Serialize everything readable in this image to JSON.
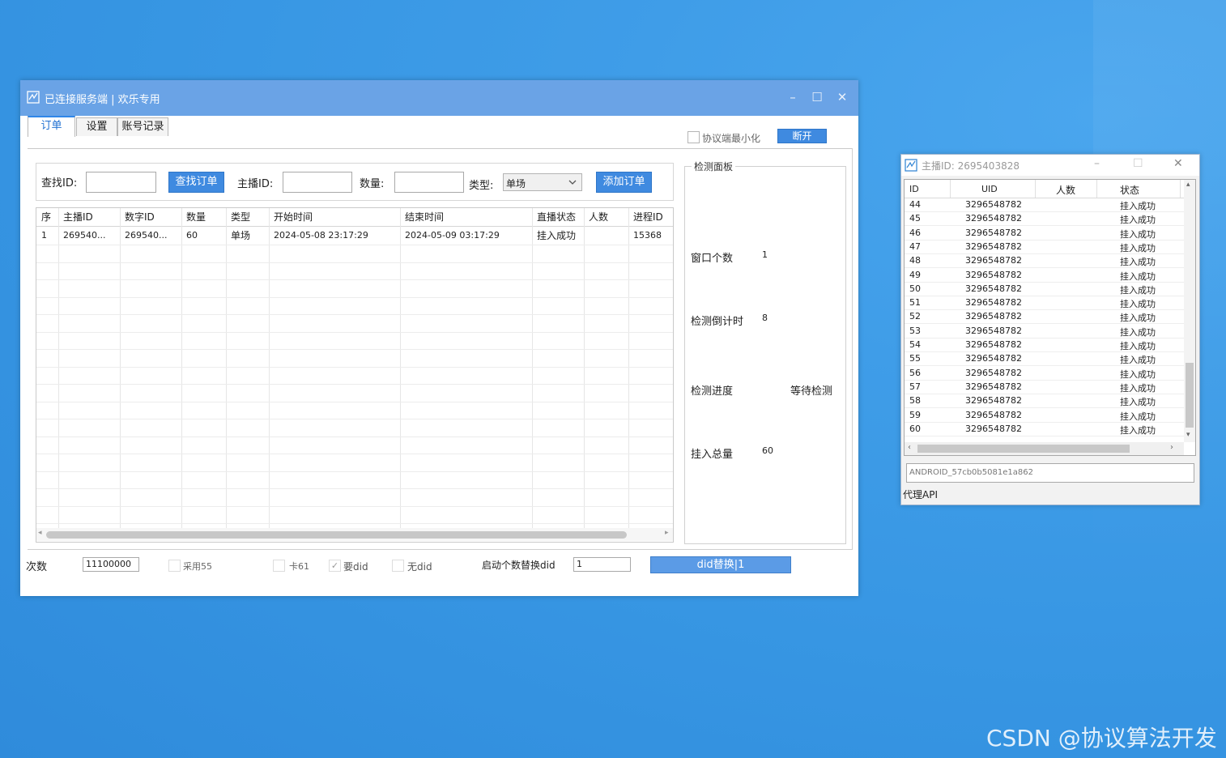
{
  "main_window": {
    "title": "已连接服务端 | 欢乐专用",
    "controls": [
      "–",
      "☐",
      "✕"
    ],
    "tabs": [
      {
        "label": "订单",
        "active": true
      },
      {
        "label": "设置",
        "active": false
      },
      {
        "label": "账号记录",
        "active": false
      }
    ],
    "protocol_minimize_label": "协议端最小化",
    "disconnect_label": "断开",
    "search": {
      "find_id_label": "查找ID:",
      "find_id_value": "",
      "find_button": "查找订单",
      "anchor_id_label": "主播ID:",
      "anchor_id_value": "",
      "quantity_label": "数量:",
      "quantity_value": "",
      "type_label": "类型:",
      "type_value": "单场",
      "add_button": "添加订单"
    },
    "table": {
      "columns": [
        "序",
        "主播ID",
        "数字ID",
        "数量",
        "类型",
        "开始时间",
        "结束时间",
        "直播状态",
        "人数",
        "进程ID"
      ],
      "rows": [
        [
          "1",
          "269540...",
          "269540...",
          "60",
          "单场",
          "2024-05-08 23:17:29",
          "2024-05-09 03:17:29",
          "挂入成功",
          "",
          "15368"
        ]
      ]
    },
    "detect_panel": {
      "title": "检测面板",
      "window_count_label": "窗口个数",
      "window_count_value": "1",
      "countdown_label": "检测倒计时",
      "countdown_value": "8",
      "progress_label": "检测进度",
      "progress_value": "等待检测",
      "total_label": "挂入总量",
      "total_value": "60"
    },
    "bottom": {
      "count_label": "次数",
      "count_value": "11100000",
      "use55_label": "采用55",
      "card61_label": "卡61",
      "need_did_label": "要did",
      "no_did_label": "无did",
      "start_replace_label": "启动个数替换did",
      "start_replace_value": "1",
      "did_replace_button": "did替换|1"
    }
  },
  "secondary_window": {
    "title": "主播ID: 2695403828",
    "controls": [
      "–",
      "☐",
      "✕"
    ],
    "columns": [
      "ID",
      "UID",
      "人数",
      "状态"
    ],
    "rows": [
      {
        "id": "44",
        "uid": "3296548782",
        "count": "",
        "status": "挂入成功"
      },
      {
        "id": "45",
        "uid": "3296548782",
        "count": "",
        "status": "挂入成功"
      },
      {
        "id": "46",
        "uid": "3296548782",
        "count": "",
        "status": "挂入成功"
      },
      {
        "id": "47",
        "uid": "3296548782",
        "count": "",
        "status": "挂入成功"
      },
      {
        "id": "48",
        "uid": "3296548782",
        "count": "",
        "status": "挂入成功"
      },
      {
        "id": "49",
        "uid": "3296548782",
        "count": "",
        "status": "挂入成功"
      },
      {
        "id": "50",
        "uid": "3296548782",
        "count": "",
        "status": "挂入成功"
      },
      {
        "id": "51",
        "uid": "3296548782",
        "count": "",
        "status": "挂入成功"
      },
      {
        "id": "52",
        "uid": "3296548782",
        "count": "",
        "status": "挂入成功"
      },
      {
        "id": "53",
        "uid": "3296548782",
        "count": "",
        "status": "挂入成功"
      },
      {
        "id": "54",
        "uid": "3296548782",
        "count": "",
        "status": "挂入成功"
      },
      {
        "id": "55",
        "uid": "3296548782",
        "count": "",
        "status": "挂入成功"
      },
      {
        "id": "56",
        "uid": "3296548782",
        "count": "",
        "status": "挂入成功"
      },
      {
        "id": "57",
        "uid": "3296548782",
        "count": "",
        "status": "挂入成功"
      },
      {
        "id": "58",
        "uid": "3296548782",
        "count": "",
        "status": "挂入成功"
      },
      {
        "id": "59",
        "uid": "3296548782",
        "count": "",
        "status": "挂入成功"
      },
      {
        "id": "60",
        "uid": "3296548782",
        "count": "",
        "status": "挂入成功"
      }
    ],
    "android_id": "ANDROID_57cb0b5081e1a862",
    "proxy_label": "代理API"
  },
  "watermark": "CSDN @协议算法开发",
  "colors": {
    "desktop": "#3796e3",
    "titlebar": "#6aa3e6",
    "button": "#3f8ae0",
    "tab_accent": "#1e6fd1"
  }
}
